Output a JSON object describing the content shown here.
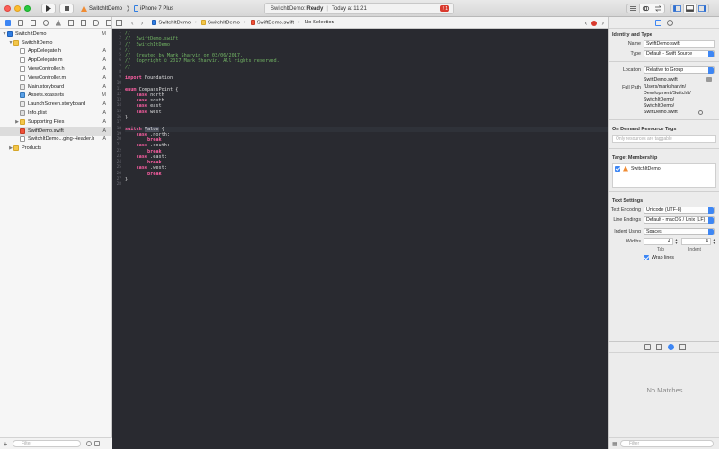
{
  "toolbar": {
    "scheme_name": "SwitchItDemo",
    "device": "iPhone 7 Plus",
    "status_project": "SwitchItDemo:",
    "status_state": "Ready",
    "status_time": "Today at 11:21",
    "error_count": "1"
  },
  "navigator": {
    "filter_placeholder": "Filter",
    "items": [
      {
        "label": "SwitchItDemo",
        "status": "M",
        "indent": 0,
        "disclosure": "▼",
        "icon": "proj"
      },
      {
        "label": "SwitchItDemo",
        "status": "",
        "indent": 1,
        "disclosure": "▼",
        "icon": "folder"
      },
      {
        "label": "AppDelegate.h",
        "status": "A",
        "indent": 2,
        "disclosure": "",
        "icon": "hfile"
      },
      {
        "label": "AppDelegate.m",
        "status": "A",
        "indent": 2,
        "disclosure": "",
        "icon": "mfile"
      },
      {
        "label": "ViewController.h",
        "status": "A",
        "indent": 2,
        "disclosure": "",
        "icon": "hfile"
      },
      {
        "label": "ViewController.m",
        "status": "A",
        "indent": 2,
        "disclosure": "",
        "icon": "mfile"
      },
      {
        "label": "Main.storyboard",
        "status": "A",
        "indent": 2,
        "disclosure": "",
        "icon": "sbfile"
      },
      {
        "label": "Assets.xcassets",
        "status": "M",
        "indent": 2,
        "disclosure": "",
        "icon": "assetfile"
      },
      {
        "label": "LaunchScreen.storyboard",
        "status": "A",
        "indent": 2,
        "disclosure": "",
        "icon": "sbfile"
      },
      {
        "label": "Info.plist",
        "status": "A",
        "indent": 2,
        "disclosure": "",
        "icon": "plistfile"
      },
      {
        "label": "Supporting Files",
        "status": "A",
        "indent": 2,
        "disclosure": "▶",
        "icon": "folder"
      },
      {
        "label": "SwiftDemo.swift",
        "status": "A",
        "indent": 2,
        "disclosure": "",
        "icon": "swiftfile",
        "selected": true
      },
      {
        "label": "SwitchItDemo...ging-Header.h",
        "status": "A",
        "indent": 2,
        "disclosure": "",
        "icon": "hfile"
      },
      {
        "label": "Products",
        "status": "",
        "indent": 1,
        "disclosure": "▶",
        "icon": "folder"
      }
    ]
  },
  "jumpbar": {
    "crumbs": [
      "SwitchItDemo",
      "SwitchItDemo",
      "SwiftDemo.swift",
      "No Selection"
    ]
  },
  "editor": {
    "highlight_line": 18,
    "lines": [
      [
        [
          "comment",
          "//"
        ]
      ],
      [
        [
          "comment",
          "//  SwiftDemo.swift"
        ]
      ],
      [
        [
          "comment",
          "//  SwitchItDemo"
        ]
      ],
      [
        [
          "comment",
          "//"
        ]
      ],
      [
        [
          "comment",
          "//  Created by Mark Sharvin on 03/06/2017."
        ]
      ],
      [
        [
          "comment",
          "//  Copyright © 2017 Mark Sharvin. All rights reserved."
        ]
      ],
      [
        [
          "comment",
          "//"
        ]
      ],
      [],
      [
        [
          "kw",
          "import"
        ],
        [
          "plain",
          " Foundation"
        ]
      ],
      [],
      [
        [
          "kw",
          "enum"
        ],
        [
          "plain",
          " CompassPoint {"
        ]
      ],
      [
        [
          "plain",
          "    "
        ],
        [
          "kw",
          "case"
        ],
        [
          "plain",
          " north"
        ]
      ],
      [
        [
          "plain",
          "    "
        ],
        [
          "kw",
          "case"
        ],
        [
          "plain",
          " south"
        ]
      ],
      [
        [
          "plain",
          "    "
        ],
        [
          "kw",
          "case"
        ],
        [
          "plain",
          " east"
        ]
      ],
      [
        [
          "plain",
          "    "
        ],
        [
          "kw",
          "case"
        ],
        [
          "plain",
          " west"
        ]
      ],
      [
        [
          "plain",
          "}"
        ]
      ],
      [],
      [
        [
          "kw",
          "switch"
        ],
        [
          "plain",
          " "
        ],
        [
          "sel",
          "Value"
        ],
        [
          "plain",
          " {"
        ]
      ],
      [
        [
          "plain",
          "    "
        ],
        [
          "kw",
          "case"
        ],
        [
          "plain",
          " .north:"
        ]
      ],
      [
        [
          "plain",
          "        "
        ],
        [
          "kw",
          "break"
        ]
      ],
      [
        [
          "plain",
          "    "
        ],
        [
          "kw",
          "case"
        ],
        [
          "plain",
          " .south:"
        ]
      ],
      [
        [
          "plain",
          "        "
        ],
        [
          "kw",
          "break"
        ]
      ],
      [
        [
          "plain",
          "    "
        ],
        [
          "kw",
          "case"
        ],
        [
          "plain",
          " .east:"
        ]
      ],
      [
        [
          "plain",
          "        "
        ],
        [
          "kw",
          "break"
        ]
      ],
      [
        [
          "plain",
          "    "
        ],
        [
          "kw",
          "case"
        ],
        [
          "plain",
          " .west:"
        ]
      ],
      [
        [
          "plain",
          "        "
        ],
        [
          "kw",
          "break"
        ]
      ],
      [
        [
          "plain",
          "}"
        ]
      ],
      []
    ]
  },
  "inspector": {
    "identity_title": "Identity and Type",
    "name_label": "Name",
    "name_value": "SwiftDemo.swift",
    "type_label": "Type",
    "type_value": "Default - Swift Source",
    "location_label": "Location",
    "location_value": "Relative to Group",
    "location_file": "SwiftDemo.swift",
    "fullpath_label": "Full Path",
    "fullpath_lines": [
      "/Users/marksharvin/",
      "Development/SwitchIt/",
      "SwitchItDemo/",
      "SwitchItDemo/",
      "SwiftDemo.swift"
    ],
    "odr_title": "On Demand Resource Tags",
    "odr_placeholder": "Only resources are taggable",
    "target_title": "Target Membership",
    "target_name": "SwitchItDemo",
    "text_title": "Text Settings",
    "encoding_label": "Text Encoding",
    "encoding_value": "Unicode (UTF-8)",
    "endings_label": "Line Endings",
    "endings_value": "Default - macOS / Unix (LF)",
    "indent_label": "Indent Using",
    "indent_value": "Spaces",
    "widths_label": "Widths",
    "tab_value": "4",
    "indent_width_value": "4",
    "tab_sublabel": "Tab",
    "indent_sublabel": "Indent",
    "wrap_label": "Wrap lines",
    "no_matches": "No Matches",
    "library_filter_placeholder": "Filter"
  }
}
